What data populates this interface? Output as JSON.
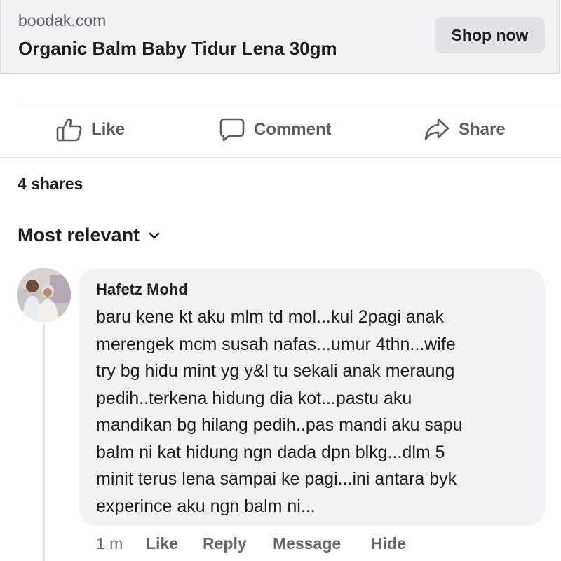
{
  "link_preview": {
    "domain": "boodak.com",
    "title": "Organic Balm Baby Tidur Lena 30gm",
    "cta_label": "Shop now"
  },
  "actions": {
    "like_label": "Like",
    "comment_label": "Comment",
    "share_label": "Share"
  },
  "shares_text": "4 shares",
  "sort_label": "Most relevant",
  "comment": {
    "author": "Hafetz Mohd",
    "lines": [
      "baru kene kt aku mlm td mol...kul 2pagi anak",
      "merengek mcm susah nafas...umur 4thn...wife",
      "try bg hidu mint yg y&l tu sekali anak meraung",
      "pedih..terkena hidung dia kot...pastu aku",
      "mandikan bg hilang pedih..pas mandi aku sapu",
      "balm ni kat hidung ngn dada dpn blkg...dlm 5",
      "minit terus lena sampai ke pagi...ini antara byk",
      "experince aku ngn balm ni..."
    ],
    "time": "1 m",
    "like_label": "Like",
    "reply_label": "Reply",
    "message_label": "Message",
    "hide_label": "Hide"
  },
  "icons": {
    "like": "thumbs-up-icon",
    "comment": "speech-bubble-icon",
    "share": "share-arrow-icon",
    "sort": "chevron-down-icon"
  },
  "colors": {
    "text_primary": "#1c1e21",
    "text_secondary": "#65676b",
    "bubble_bg": "#f0f2f5",
    "button_bg": "#dfe2e6"
  }
}
